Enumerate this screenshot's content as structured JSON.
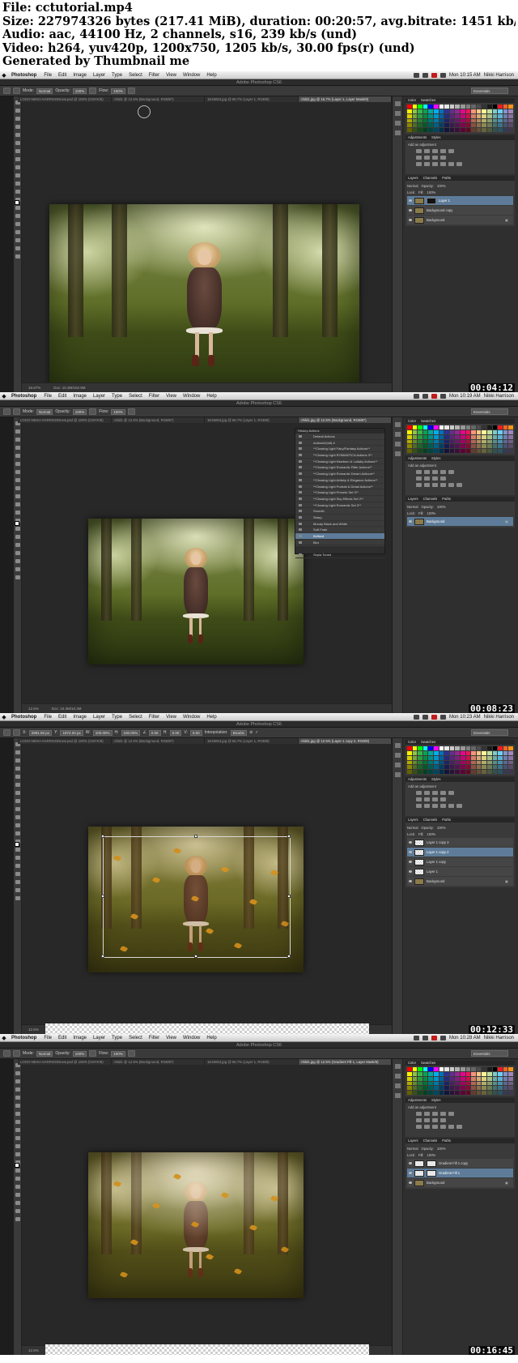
{
  "header": {
    "line1": "File: cctutorial.mp4",
    "line2": "Size: 227974326 bytes (217.41 MiB), duration: 00:20:57, avg.bitrate: 1451 kb/s",
    "line3": "Audio: aac, 44100 Hz, 2 channels, s16, 239 kb/s (und)",
    "line4": "Video: h264, yuv420p, 1200x750, 1205 kb/s, 30.00 fps(r) (und)",
    "line5": "Generated by Thumbnail me"
  },
  "menubar": {
    "app": "Photoshop",
    "items": [
      "File",
      "Edit",
      "Image",
      "Layer",
      "Type",
      "Select",
      "Filter",
      "View",
      "Window",
      "Help"
    ],
    "user": "Nikki Harrison"
  },
  "window_title": "Adobe Photoshop CS6",
  "options": {
    "mode_label": "Mode:",
    "mode_value": "Normal",
    "opacity_label": "Opacity:",
    "opacity_value": "100%",
    "flow_label": "Flow:",
    "flow_value": "100%",
    "preset": "Essentials"
  },
  "panels": {
    "swatches_tab": "Color",
    "swatches_tab2": "Swatches",
    "adjustments_tab": "Adjustments",
    "styles_tab": "Styles",
    "add_adjustment": "Add an adjustment",
    "layers_tab": "Layers",
    "channels_tab": "Channels",
    "paths_tab": "Paths",
    "blend": "Normal",
    "opacity_label": "Opacity:",
    "opacity_value": "100%",
    "fill_label": "Fill:",
    "fill_value": "100%",
    "lock_label": "Lock:"
  },
  "frames": [
    {
      "timestamp": "00:04:12",
      "clock": "Mon 10:15 AM",
      "tabs": [
        "LOGO-NIKKI-HARRISONnew.psd @ 100% (CMYK/8)",
        "child1 @ 12.5% (Background, RGB/8*)",
        "1E45053.jpg @ 66.7% (Layer 1, RGB/8)",
        "child1.jpg @ 16.7% (Layer 1, Layer Mask/8)"
      ],
      "zoom": "16.67%",
      "doc": "Doc: 10.3M/102.9M",
      "layers": [
        {
          "name": "Layer 1",
          "sel": true,
          "thumb": "mask"
        },
        {
          "name": "Background copy",
          "sel": false,
          "thumb": "photo"
        },
        {
          "name": "Background",
          "sel": false,
          "thumb": "photo",
          "lock": true
        }
      ]
    },
    {
      "timestamp": "00:08:23",
      "clock": "Mon 10:19 AM",
      "tabs": [
        "LOGO-NIKKI-HARRISONnew.psd @ 100% (CMYK/8)",
        "child1 @ 12.5% (Background, RGB/8*)",
        "1E45053.jpg @ 66.7% (Layer 1, RGB/8)",
        "child1.jpg @ 12.5% (Background, RGB/8*)"
      ],
      "zoom": "12.5%",
      "doc": "Doc: 10.3M/10.3M",
      "actions_tab": "Actions",
      "history_tab": "History",
      "actions": [
        "Default Actions",
        "Actions2(mlt) #",
        "**Chasing Light Fairy/Fantasy Actions**",
        "**Chasing Light ROMANTICA Actions 3**",
        "**Chasing Light Newborn & Lullaby Actions**",
        "**Chasing Light Romantic Filter Actions**",
        "**Chasing Light Romantic Dream Actions**",
        "**Chasing Light Artistry & Elegance Actions**",
        "**Chasing Light Portrait & Detail Actions**",
        "**Chasing Light Presets Set 3**",
        "**Chasing Light Sky Effects Set 2**",
        "**Chasing Light Romantic Set 3**",
        "Smooth",
        "Sharp",
        "Moody Black and White",
        "Soft Fade",
        "Brilliant",
        "Blur",
        "Vintage",
        "Sepia Toned"
      ],
      "actions_selected": 16,
      "layers": [
        {
          "name": "Background",
          "sel": true,
          "thumb": "photo",
          "lock": true
        }
      ]
    },
    {
      "timestamp": "00:12:33",
      "clock": "Mon 10:23 AM",
      "tabs": [
        "LOGO-NIKKI-HARRISONnew.psd @ 100% (CMYK/8)",
        "child1 @ 12.5% (Background, RGB/8*)",
        "1E45053.jpg @ 66.7% (Layer 1, RGB/8)",
        "child1.jpg @ 12.5% (Layer 1 copy 2, RGB/8)"
      ],
      "zoom": "12.5%",
      "doc": "Doc: 10.3M/41.2M",
      "transform": {
        "x": "2991.50 px",
        "y": "1872.00 px",
        "w": "100.00%",
        "h": "100.00%",
        "angle": "0.00",
        "hskew": "0.00",
        "vskew": "0.00",
        "interp": "Bicubic"
      },
      "layers": [
        {
          "name": "Layer 1 copy 3",
          "sel": false,
          "thumb": "checker"
        },
        {
          "name": "Layer 1 copy 2",
          "sel": true,
          "thumb": "checker"
        },
        {
          "name": "Layer 1 copy",
          "sel": false,
          "thumb": "checker"
        },
        {
          "name": "Layer 1",
          "sel": false,
          "thumb": "checker"
        },
        {
          "name": "Background",
          "sel": false,
          "thumb": "photo",
          "lock": true
        }
      ]
    },
    {
      "timestamp": "00:16:45",
      "clock": "Mon 10:28 AM",
      "tabs": [
        "LOGO-NIKKI-HARRISONnew.psd @ 100% (CMYK/8)",
        "child1 @ 12.5% (Background, RGB/8*)",
        "1E45053.jpg @ 66.7% (Layer 1, RGB/8)",
        "child1.jpg @ 12.5% (Gradient Fill 1, Layer Mask/8)"
      ],
      "zoom": "12.5%",
      "doc": "Doc: 10.3M/10.3M",
      "layers": [
        {
          "name": "Gradient Fill 1 copy",
          "sel": false,
          "thumb": "white"
        },
        {
          "name": "Gradient Fill 1",
          "sel": true,
          "thumb": "white"
        },
        {
          "name": "Background",
          "sel": false,
          "thumb": "photo",
          "lock": true
        }
      ]
    }
  ],
  "colors": {
    "accent": "#5e7c99",
    "ui_bg": "#1d1d1d",
    "panel": "#3a3a3a"
  }
}
